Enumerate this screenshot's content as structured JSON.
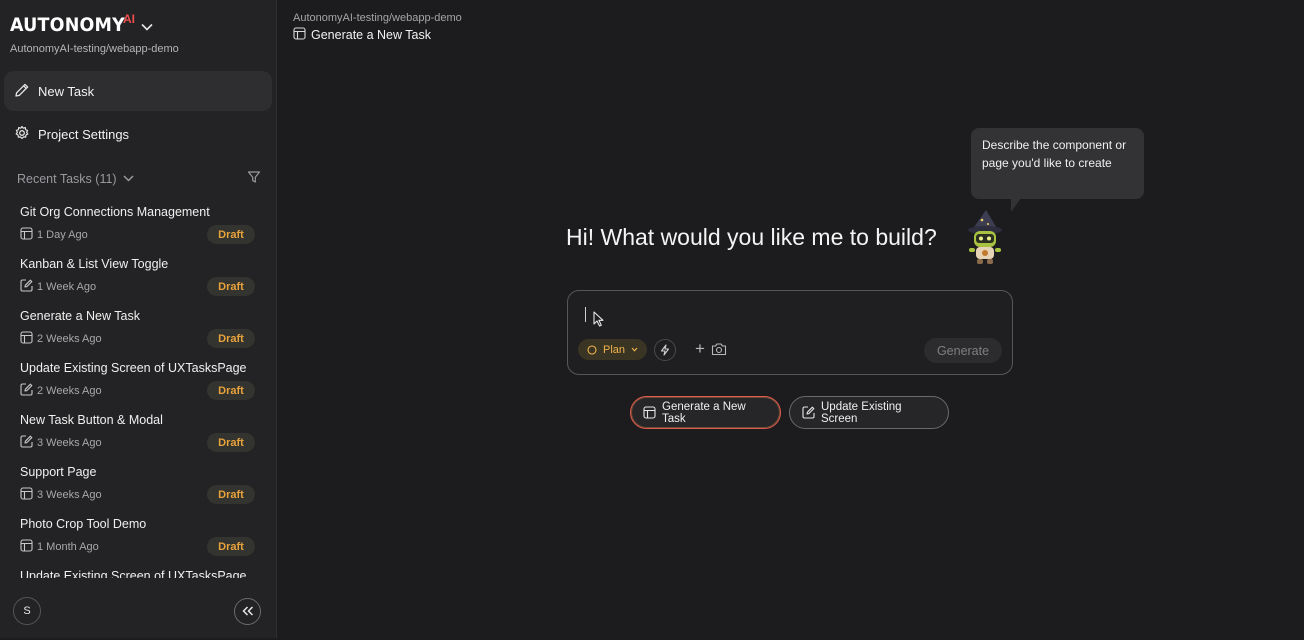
{
  "brand": {
    "name": "AUTONOMY",
    "superscript": "AI",
    "subtitle": "AutonomyAI-testing/webapp-demo",
    "accent": "#ef4e4e"
  },
  "sidebar": {
    "nav": [
      {
        "label": "New Task",
        "icon": "pencil-icon",
        "active": true
      },
      {
        "label": "Project Settings",
        "icon": "gear-icon",
        "active": false
      }
    ],
    "recent_label": "Recent Tasks (11)",
    "tasks": [
      {
        "title": "Git Org Connections Management",
        "time": "1 Day Ago",
        "status": "Draft",
        "icon": "layout-icon"
      },
      {
        "title": "Kanban & List View Toggle",
        "time": "1 Week Ago",
        "status": "Draft",
        "icon": "edit-screen-icon"
      },
      {
        "title": "Generate a New Task",
        "time": "2 Weeks Ago",
        "status": "Draft",
        "icon": "layout-icon"
      },
      {
        "title": "Update Existing Screen of UXTasksPage",
        "time": "2 Weeks Ago",
        "status": "Draft",
        "icon": "edit-screen-icon"
      },
      {
        "title": "New Task Button & Modal",
        "time": "3 Weeks Ago",
        "status": "Draft",
        "icon": "edit-screen-icon"
      },
      {
        "title": "Support Page",
        "time": "3 Weeks Ago",
        "status": "Draft",
        "icon": "layout-icon"
      },
      {
        "title": "Photo Crop Tool Demo",
        "time": "1 Month Ago",
        "status": "Draft",
        "icon": "layout-icon"
      },
      {
        "title": "Update Existing Screen of UXTasksPage",
        "time": "",
        "status": "",
        "icon": ""
      }
    ],
    "avatar_initial": "S"
  },
  "header": {
    "breadcrumb": "AutonomyAI-testing/webapp-demo",
    "title": "Generate a New Task"
  },
  "main": {
    "tooltip": "Describe the component or page you'd like to create",
    "heading": "Hi! What would you like me to build?",
    "prompt": {
      "value": "",
      "mode_label": "Plan",
      "generate_label": "Generate"
    },
    "actions": [
      {
        "label": "Generate a New Task",
        "icon": "layout-icon",
        "selected": true
      },
      {
        "label": "Update Existing Screen",
        "icon": "edit-screen-icon",
        "selected": false
      }
    ]
  },
  "colors": {
    "draft": "#e8a33b",
    "plan": "#f0b44a",
    "background": "#1c1c1e",
    "sidebar": "#232325"
  }
}
